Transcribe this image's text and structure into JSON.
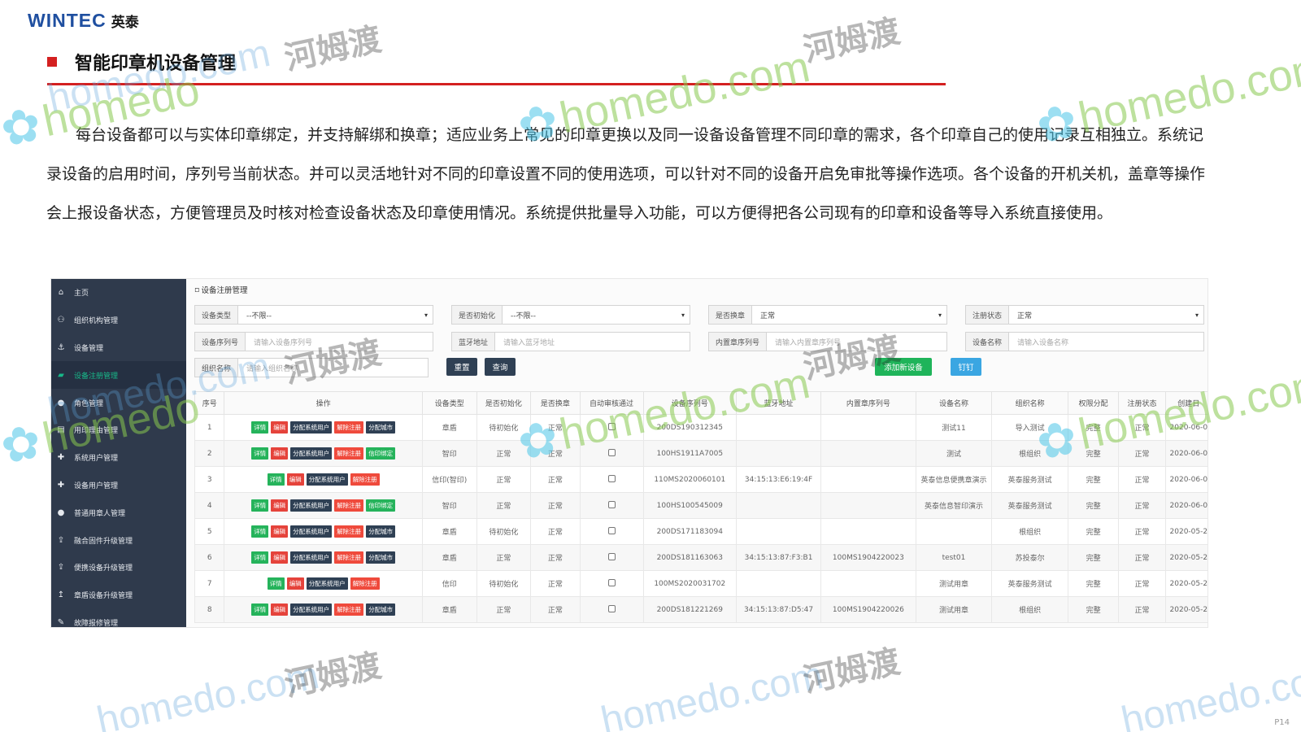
{
  "logo": {
    "brand": "WINTEC",
    "cn": "英泰"
  },
  "section_title": "智能印章机设备管理",
  "paragraph": "每台设备都可以与实体印章绑定，并支持解绑和换章；适应业务上常见的印章更换以及同一设备设备管理不同印章的需求，各个印章自己的使用记录互相独立。系统记录设备的启用时间，序列号当前状态。并可以灵活地针对不同的印章设置不同的使用选项，可以针对不同的设备开启免审批等操作选项。各个设备的开机关机，盖章等操作会上报设备状态，方便管理员及时核对检查设备状态及印章使用情况。系统提供批量导入功能，可以方便得把各公司现有的印章和设备等导入系统直接使用。",
  "ui": {
    "sidebar": [
      {
        "label": "主页",
        "icon": "home-icon",
        "glyph": "⌂"
      },
      {
        "label": "组织机构管理",
        "icon": "org-icon",
        "glyph": "⚇"
      },
      {
        "label": "设备管理",
        "icon": "anchor-icon",
        "glyph": "⚓"
      },
      {
        "label": "设备注册管理",
        "icon": "book-icon",
        "glyph": "▰",
        "active": true
      },
      {
        "label": "角色管理",
        "icon": "user-icon",
        "glyph": "●"
      },
      {
        "label": "用印理由管理",
        "icon": "file-icon",
        "glyph": "▤"
      },
      {
        "label": "系统用户管理",
        "icon": "pin-icon",
        "glyph": "✚"
      },
      {
        "label": "设备用户管理",
        "icon": "pin-icon",
        "glyph": "✚"
      },
      {
        "label": "普通用章人管理",
        "icon": "user-icon",
        "glyph": "●"
      },
      {
        "label": "融合固件升级管理",
        "icon": "upload-icon",
        "glyph": "⇪"
      },
      {
        "label": "便携设备升级管理",
        "icon": "upload-icon",
        "glyph": "⇪"
      },
      {
        "label": "章盾设备升级管理",
        "icon": "upload-icon",
        "glyph": "↥"
      },
      {
        "label": "故障报修管理",
        "icon": "wrench-icon",
        "glyph": "✎"
      }
    ],
    "breadcrumb": "设备注册管理",
    "filters_row1": [
      {
        "label": "设备类型",
        "value": "--不限--"
      },
      {
        "label": "是否初始化",
        "value": "--不限--"
      },
      {
        "label": "是否换章",
        "value": "正常"
      },
      {
        "label": "注册状态",
        "value": "正常"
      }
    ],
    "filters_row2": [
      {
        "label": "设备序列号",
        "placeholder": "请输入设备序列号"
      },
      {
        "label": "蓝牙地址",
        "placeholder": "请输入蓝牙地址"
      },
      {
        "label": "内置章序列号",
        "placeholder": "请输入内置章序列号"
      },
      {
        "label": "设备名称",
        "placeholder": "请输入设备名称"
      }
    ],
    "filter_org": {
      "label": "组织名称",
      "placeholder": "请输入组织名称"
    },
    "buttons": {
      "reset": "重置",
      "query": "查询",
      "add": "添加新设备",
      "dingtalk": "钉钉"
    },
    "columns": [
      "序号",
      "操作",
      "设备类型",
      "是否初始化",
      "是否换章",
      "自动审核通过",
      "设备序列号",
      "蓝牙地址",
      "内置章序列号",
      "设备名称",
      "组织名称",
      "权限分配",
      "注册状态",
      "创建日"
    ],
    "ops": {
      "detail": "详情",
      "edit": "编辑",
      "assign_user": "分配系统用户",
      "unregister": "解除注册",
      "assign_city": "分配城市",
      "bind_seal": "信印绑定"
    },
    "rows": [
      {
        "no": "1",
        "extra": "分配城市",
        "type": "章盾",
        "init": "待初始化",
        "swap": "正常",
        "serial": "200DS190312345",
        "bt": "",
        "seal": "",
        "name": "测试11",
        "org": "导入测试",
        "perm": "完整",
        "status": "正常",
        "date": "2020-06-0"
      },
      {
        "no": "2",
        "extra": "信印绑定",
        "type": "智印",
        "init": "正常",
        "swap": "正常",
        "serial": "100HS1911A7005",
        "bt": "",
        "seal": "",
        "name": "测试",
        "org": "根组织",
        "perm": "完整",
        "status": "正常",
        "date": "2020-06-0"
      },
      {
        "no": "3",
        "extra": "",
        "type": "信印(智印)",
        "init": "正常",
        "swap": "正常",
        "serial": "110MS2020060101",
        "bt": "34:15:13:E6:19:4F",
        "seal": "",
        "name": "英泰信息便携章演示",
        "org": "英泰服务测试",
        "perm": "完整",
        "status": "正常",
        "date": "2020-06-0"
      },
      {
        "no": "4",
        "extra": "信印绑定",
        "type": "智印",
        "init": "正常",
        "swap": "正常",
        "serial": "100HS100545009",
        "bt": "",
        "seal": "",
        "name": "英泰信息智印演示",
        "org": "英泰服务测试",
        "perm": "完整",
        "status": "正常",
        "date": "2020-06-0"
      },
      {
        "no": "5",
        "extra": "分配城市",
        "type": "章盾",
        "init": "待初始化",
        "swap": "正常",
        "serial": "200DS171183094",
        "bt": "",
        "seal": "",
        "name": "",
        "org": "根组织",
        "perm": "完整",
        "status": "正常",
        "date": "2020-05-2"
      },
      {
        "no": "6",
        "extra": "分配城市",
        "type": "章盾",
        "init": "正常",
        "swap": "正常",
        "serial": "200DS181163063",
        "bt": "34:15:13:87:F3:B1",
        "seal": "100MS1904220023",
        "name": "test01",
        "org": "苏投泰尔",
        "perm": "完整",
        "status": "正常",
        "date": "2020-05-2"
      },
      {
        "no": "7",
        "extra": "",
        "type": "信印",
        "init": "待初始化",
        "swap": "正常",
        "serial": "100MS2020031702",
        "bt": "",
        "seal": "",
        "name": "测试用章",
        "org": "英泰服务测试",
        "perm": "完整",
        "status": "正常",
        "date": "2020-05-2"
      },
      {
        "no": "8",
        "extra": "分配城市",
        "type": "章盾",
        "init": "正常",
        "swap": "正常",
        "serial": "200DS181221269",
        "bt": "34:15:13:87:D5:47",
        "seal": "100MS1904220026",
        "name": "测试用章",
        "org": "根组织",
        "perm": "完整",
        "status": "正常",
        "date": "2020-05-2"
      }
    ]
  },
  "watermark": {
    "text": "homedo",
    "url": "homedo.com",
    "cn": "河姆渡"
  },
  "page_number": "P14",
  "colors": {
    "brand_blue": "#1f4fa0",
    "accent_red": "#d42020",
    "sidebar": "#2f3a4c",
    "active_green": "#18b889"
  }
}
